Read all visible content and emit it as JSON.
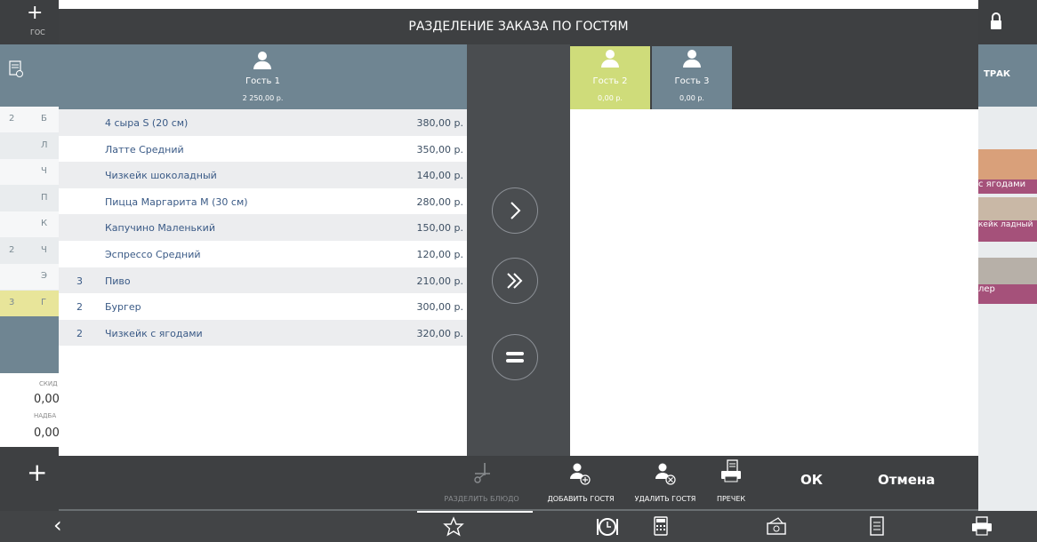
{
  "modal": {
    "title": "РАЗДЕЛЕНИЕ ЗАКАЗА ПО ГОСТЯМ",
    "left_guest": {
      "name": "Гость 1",
      "total": "2 250,00 р."
    },
    "right_guests": [
      {
        "name": "Гость 2",
        "total": "0,00 р.",
        "selected": true
      },
      {
        "name": "Гость 3",
        "total": "0,00 р.",
        "selected": false
      }
    ],
    "items": [
      {
        "qty": "",
        "name": "4 сыра S (20 см)",
        "price": "380,00 р."
      },
      {
        "qty": "",
        "name": "Латте Средний",
        "price": "350,00 р."
      },
      {
        "qty": "",
        "name": "Чизкейк шоколадный",
        "price": "140,00 р."
      },
      {
        "qty": "",
        "name": "Пицца Маргарита М (30 см)",
        "price": "280,00 р."
      },
      {
        "qty": "",
        "name": "Капучино Маленький",
        "price": "150,00 р."
      },
      {
        "qty": "",
        "name": "Эспрессо Средний",
        "price": "120,00 р."
      },
      {
        "qty": "3",
        "name": "Пиво",
        "price": "210,00 р."
      },
      {
        "qty": "2",
        "name": "Бургер",
        "price": "300,00 р."
      },
      {
        "qty": "2",
        "name": "Чизкейк с ягодами",
        "price": "320,00 р."
      }
    ],
    "footer": {
      "split_dish": "РАЗДЕЛИТЬ БЛЮДО",
      "add_guest": "ДОБАВИТЬ ГОСТЯ",
      "remove_guest": "УДАЛИТЬ ГОСТЯ",
      "precheck": "ПРЕЧЕК",
      "ok": "ОК",
      "cancel": "Отмена"
    }
  },
  "background": {
    "left_header": "ГОС",
    "left_rows": [
      {
        "n": "2",
        "c": "Б"
      },
      {
        "n": "",
        "c": "Л"
      },
      {
        "n": "",
        "c": "Ч"
      },
      {
        "n": "",
        "c": "П"
      },
      {
        "n": "",
        "c": "К"
      },
      {
        "n": "2",
        "c": "Ч"
      },
      {
        "n": "",
        "c": "Э"
      },
      {
        "n": "3",
        "c": "Г"
      }
    ],
    "discount_label": "СКИД",
    "discount_value": "0,00",
    "markup_label": "НАДБА",
    "markup_value": "0,00",
    "right_strip_label": "ТРАК",
    "right_tiles": [
      "с ягодами",
      "кейк ладный",
      "лер"
    ]
  },
  "colors": {
    "accent_yellow": "#cfdc7a",
    "header_slate": "#6f8592",
    "tile_pink": "#a5517a"
  },
  "icons": [
    "plus-icon",
    "receipt-icon",
    "person-icon",
    "chevron-right-icon",
    "double-chevron-right-icon",
    "equals-icon",
    "scissors-icon",
    "add-person-icon",
    "remove-person-icon",
    "printer-icon",
    "star-icon",
    "clock-icon",
    "calculator-icon",
    "cash-icon",
    "document-icon",
    "lock-icon",
    "back-arrow-icon"
  ]
}
